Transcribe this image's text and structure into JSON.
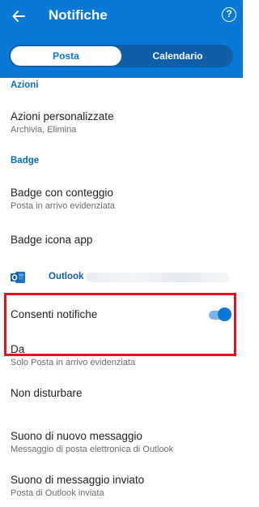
{
  "header": {
    "title": "Notifiche",
    "back_icon": "arrow-left-icon",
    "help_icon": "question-circle-icon",
    "help_glyph": "?"
  },
  "tabs": [
    {
      "label": "Posta",
      "selected": true
    },
    {
      "label": "Calendario",
      "selected": false
    }
  ],
  "sections": {
    "actions": {
      "title": "Azioni",
      "items": [
        {
          "title": "Azioni personalizzate",
          "subtitle": "Archivia, Elimina"
        }
      ]
    },
    "badge": {
      "title": "Badge",
      "items": [
        {
          "title": "Badge con conteggio",
          "subtitle": "Posta in arrivo evidenziata"
        },
        {
          "title": "Badge icona app"
        }
      ]
    }
  },
  "account": {
    "label": "Outlook ·",
    "icon": "outlook-logo-icon"
  },
  "notifications": {
    "allow_label": "Consenti notifiche",
    "allow_enabled": true,
    "from_title": "Da",
    "from_value": "Solo Posta in arrivo evidenziata"
  },
  "more_settings": [
    {
      "title": "Non disturbare"
    },
    {
      "title": "Suono di nuovo messaggio",
      "subtitle": "Messaggio di posta elettronica di Outlook"
    },
    {
      "title": "Suono di messaggio inviato",
      "subtitle": "Posta di Outlook inviata"
    }
  ],
  "colors": {
    "accent": "#0a78d7",
    "highlight": "#e3121c"
  }
}
